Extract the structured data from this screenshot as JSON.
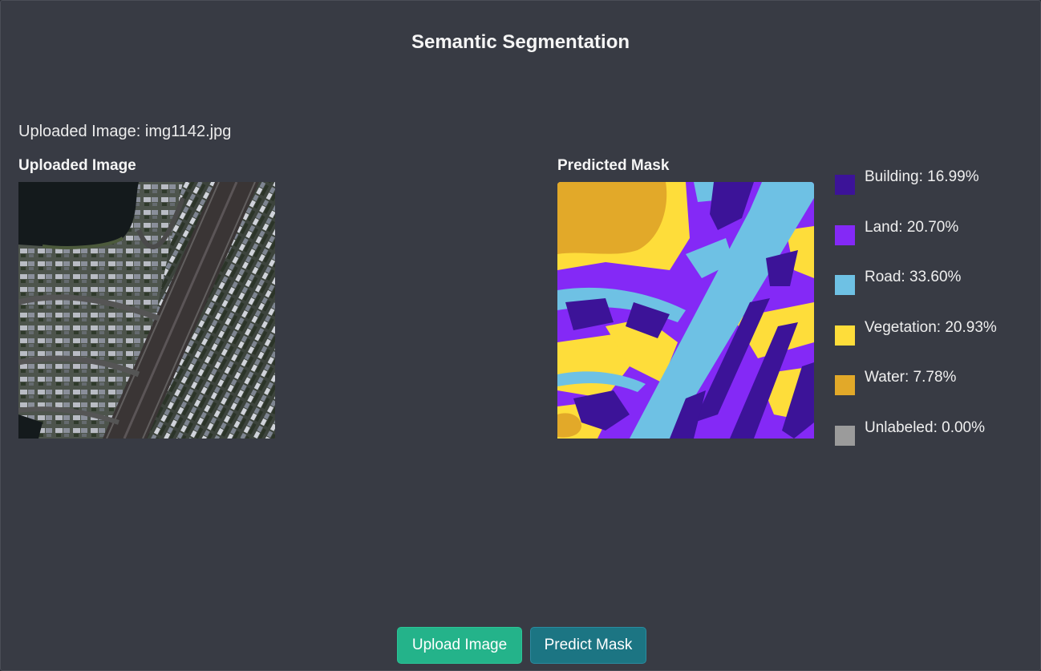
{
  "app": {
    "title": "Semantic Segmentation"
  },
  "status": {
    "uploaded_text": "Uploaded Image: img1142.jpg"
  },
  "left_panel": {
    "label": "Uploaded Image"
  },
  "right_panel": {
    "label": "Predicted Mask"
  },
  "legend": [
    {
      "text": "Building: 16.99%",
      "color": "#3c1398",
      "class": "Building",
      "percent": 16.99
    },
    {
      "text": "Land: 20.70%",
      "color": "#8429f6",
      "class": "Land",
      "percent": 20.7
    },
    {
      "text": "Road: 33.60%",
      "color": "#6ec1e4",
      "class": "Road",
      "percent": 33.6
    },
    {
      "text": "Vegetation: 20.93%",
      "color": "#fedd3a",
      "class": "Vegetation",
      "percent": 20.93
    },
    {
      "text": "Water: 7.78%",
      "color": "#e2a929",
      "class": "Water",
      "percent": 7.78
    },
    {
      "text": "Unlabeled: 0.00%",
      "color": "#9b9b9b",
      "class": "Unlabeled",
      "percent": 0.0
    }
  ],
  "buttons": {
    "upload": "Upload Image",
    "predict": "Predict Mask"
  }
}
